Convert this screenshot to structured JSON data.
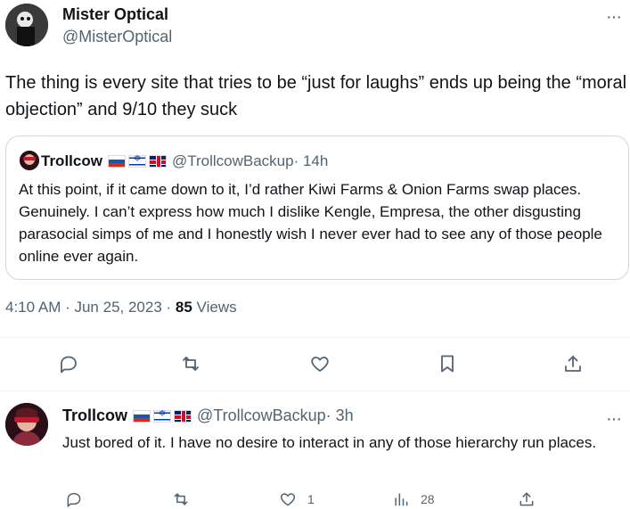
{
  "tweet": {
    "author_name": "Mister Optical",
    "author_handle": "@MisterOptical",
    "more_label": "···",
    "text": "The thing is every site that tries to be “just for laughs” ends up being the “moral objection” and 9/10 they suck",
    "timestamp": "4:10 AM · Jun 25, 2023 · ",
    "view_count": "85",
    "view_label": " Views"
  },
  "quote": {
    "author_name": "Trollcow",
    "author_handle": "@TrollcowBackup",
    "time": " · 14h",
    "text": "At this point, if it came down to it, I’d rather Kiwi Farms & Onion Farms swap places. Genuinely. I can’t express how much I dislike Kengle, Empresa, the other disgusting parasocial simps of me and I honestly wish I never ever had to see any of those people online ever again."
  },
  "reply": {
    "author_name": "Trollcow",
    "author_handle": "@TrollcowBackup",
    "time": " · 3h",
    "more_label": "···",
    "text": "Just bored of it. I have no desire to interact in any of those hierarchy run places.",
    "likes": "1",
    "views": "28"
  },
  "icons": [
    "reply-icon",
    "retweet-icon",
    "like-icon",
    "bookmark-icon",
    "share-icon",
    "views-icon"
  ],
  "colors": {
    "text": "#0f1419",
    "secondary": "#536471",
    "border": "#cfd9de"
  }
}
